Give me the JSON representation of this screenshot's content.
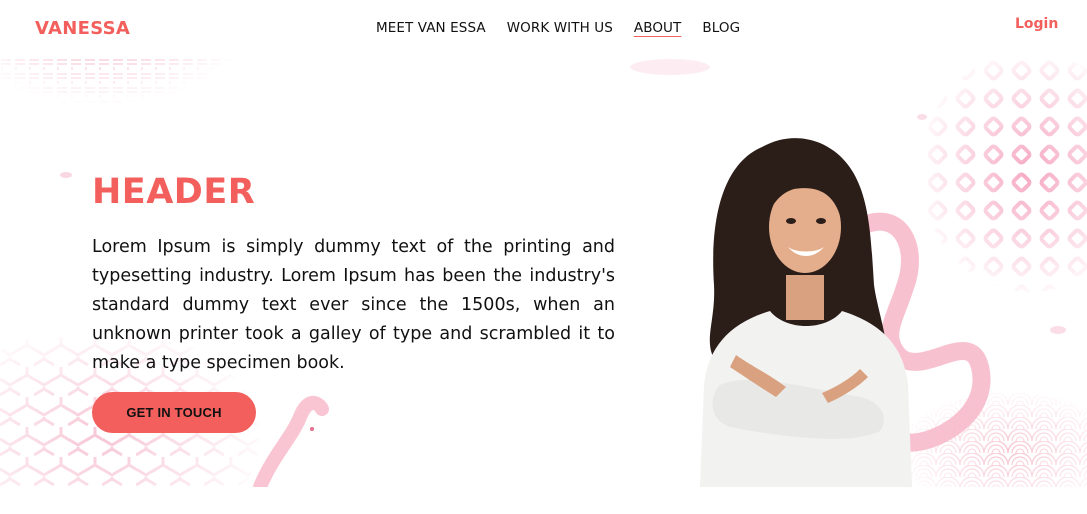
{
  "brand": {
    "name": "VANESSA"
  },
  "nav": {
    "items": [
      {
        "label": "MEET VAN ESSA"
      },
      {
        "label": "WORK WITH US"
      },
      {
        "label": "ABOUT"
      },
      {
        "label": "BLOG"
      }
    ],
    "active_index": 2
  },
  "auth": {
    "login_label": "Login"
  },
  "hero": {
    "title": "HEADER",
    "body": "Lorem Ipsum is simply dummy text of the printing and typesetting industry. Lorem Ipsum has been the industry's standard dummy text ever since the 1500s, when an unknown printer took a galley of type and scrambled it to make a type specimen book.",
    "cta_label": "GET IN TOUCH",
    "image": "woman-portrait-photo"
  },
  "colors": {
    "accent": "#f25f5c",
    "pattern_pink": "#f7b6c8",
    "text": "#111111",
    "background": "#ffffff"
  }
}
